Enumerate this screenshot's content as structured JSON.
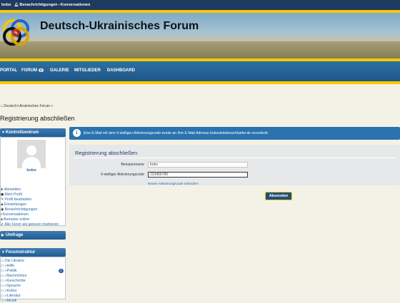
{
  "userbar": {
    "username": "bobo",
    "notifications_label": "Benachrichtigungen",
    "conversations_label": "Konversationen"
  },
  "header": {
    "title": "Deutsch-Ukrainisches Forum"
  },
  "nav": {
    "items": [
      {
        "label": "PORTAL"
      },
      {
        "label": "FORUM",
        "badge": "3"
      },
      {
        "label": "GALERIE"
      },
      {
        "label": "MITGLIEDER"
      },
      {
        "label": "DASHBOARD"
      }
    ]
  },
  "breadcrumb": {
    "home_label": "Deutsch-Ukrainisches Forum",
    "sep": "»"
  },
  "page": {
    "title": "Registrierung abschließen"
  },
  "sidebar": {
    "control_center": {
      "title": "Kontrollzentrum",
      "username": "bobo",
      "links": [
        {
          "icon": "logout-icon",
          "glyph": "⮞",
          "label": "Abmelden"
        },
        {
          "icon": "user-icon",
          "glyph": "◼",
          "label": "Mein Profil"
        },
        {
          "icon": "edit-icon",
          "glyph": "✎",
          "label": "Profil bearbeiten"
        },
        {
          "icon": "settings-icon",
          "glyph": "◈",
          "label": "Einstellungen"
        },
        {
          "icon": "bell-icon",
          "glyph": "◉",
          "label": "Benachrichtigungen"
        },
        {
          "icon": "chat-icon",
          "glyph": "▪",
          "label": "Konversationen"
        },
        {
          "icon": "users-icon",
          "glyph": "●",
          "label": "Benutzer online"
        },
        {
          "icon": "check-icon",
          "glyph": "✔",
          "label": "Alle Foren als gelesen markieren"
        }
      ]
    },
    "poll": {
      "title": "Umfrage"
    },
    "forum_structure": {
      "title": "Forumstruktur",
      "items": [
        {
          "label": "Die Ukraine",
          "indent": false,
          "count": "1"
        },
        {
          "label": "»Hilfe",
          "indent": true
        },
        {
          "label": "»Politik",
          "indent": true
        },
        {
          "label": "»Nachrichten",
          "indent": true
        },
        {
          "label": "»Geschichte",
          "indent": true
        },
        {
          "label": "»Sprache",
          "indent": true
        },
        {
          "label": "»Kultur",
          "indent": true
        },
        {
          "label": "»Literatur",
          "indent": true
        },
        {
          "label": "»Musik",
          "indent": true
        }
      ]
    }
  },
  "notice": {
    "text": "Eine E-Mail mit dem 9-stelligen Aktivierungscode wurde an Ihre E-Mail-Adresse bobostelebenschlaefer.de verschickt."
  },
  "form": {
    "title": "Registrierung abschließen",
    "username_label": "Benutzername",
    "username_value": "bobo",
    "code_label": "9-stelliger Aktivierungscode",
    "code_value": "123456789",
    "code_hint": "Neuen Aktivierungscode anfordern",
    "submit_label": "Absenden"
  },
  "colors": {
    "accent_blue": "#2a67a8",
    "nav_blue": "#1f5687",
    "brand_yellow": "#f5c800",
    "header_dark": "#1f3a5f"
  }
}
